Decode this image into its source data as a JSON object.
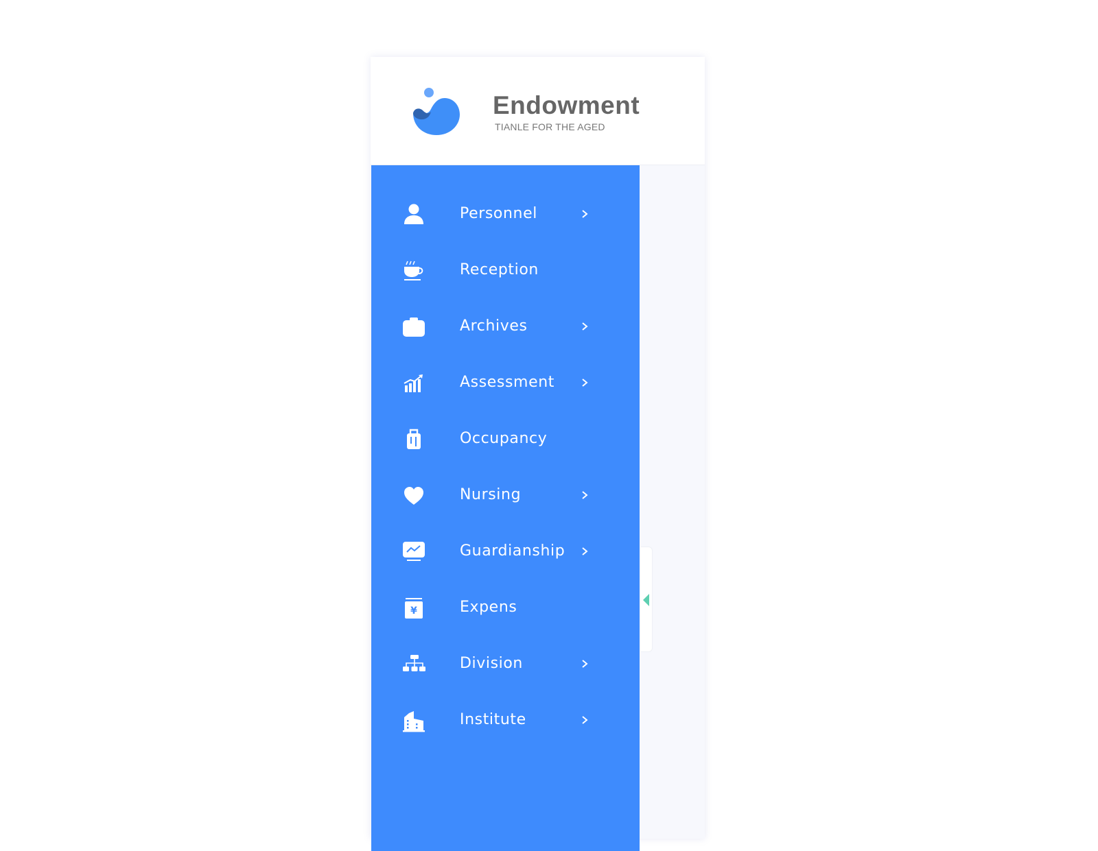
{
  "header": {
    "title": "Endowment",
    "subtitle": "TIANLE FOR THE AGED",
    "logo_icon": "water-drop-logo"
  },
  "colors": {
    "sidebar_bg": "#3e8bfd",
    "logo_primary": "#3f8ff8",
    "logo_dark": "#2f64b0",
    "logo_dot": "#6aa7fb",
    "collapse_arrow": "#5ecfb1",
    "content_bg": "#f7f8fd"
  },
  "sidebar": {
    "items": [
      {
        "label": "Personnel",
        "icon": "user-icon",
        "has_submenu": true
      },
      {
        "label": "Reception",
        "icon": "coffee-cup-icon",
        "has_submenu": false
      },
      {
        "label": "Archives",
        "icon": "briefcase-icon",
        "has_submenu": true
      },
      {
        "label": "Assessment",
        "icon": "bar-chart-trend-icon",
        "has_submenu": true
      },
      {
        "label": "Occupancy",
        "icon": "luggage-icon",
        "has_submenu": false
      },
      {
        "label": "Nursing",
        "icon": "heart-icon",
        "has_submenu": true
      },
      {
        "label": "Guardianship",
        "icon": "monitor-chart-icon",
        "has_submenu": true
      },
      {
        "label": "Expens",
        "icon": "yen-box-icon",
        "has_submenu": false
      },
      {
        "label": "Division",
        "icon": "org-chart-icon",
        "has_submenu": true
      },
      {
        "label": "Institute",
        "icon": "building-icon",
        "has_submenu": true
      }
    ]
  },
  "collapse_toggle": {
    "icon": "caret-left-icon"
  }
}
